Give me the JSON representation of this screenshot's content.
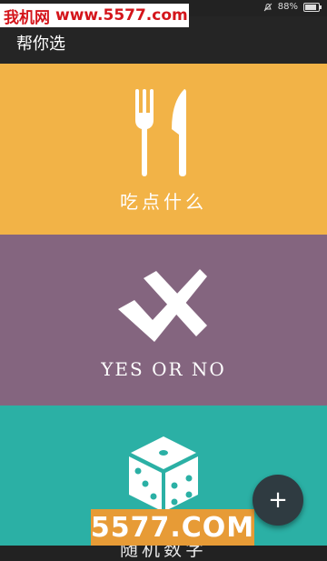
{
  "status_bar": {
    "battery_text": "88%"
  },
  "watermark": {
    "top_text": "我机网",
    "top_url": "www.5577.com",
    "bottom_text": "5577.COM"
  },
  "app_bar": {
    "title": "帮你选"
  },
  "cards": [
    {
      "label": "吃点什么",
      "icon": "fork-knife-icon",
      "color": "#f2b347"
    },
    {
      "label": "YES OR NO",
      "icon": "check-cross-icon",
      "color": "#84657f"
    },
    {
      "label": "随机数字",
      "icon": "dice-icon",
      "color": "#2bb0a5"
    }
  ],
  "fab": {
    "label": "+"
  }
}
